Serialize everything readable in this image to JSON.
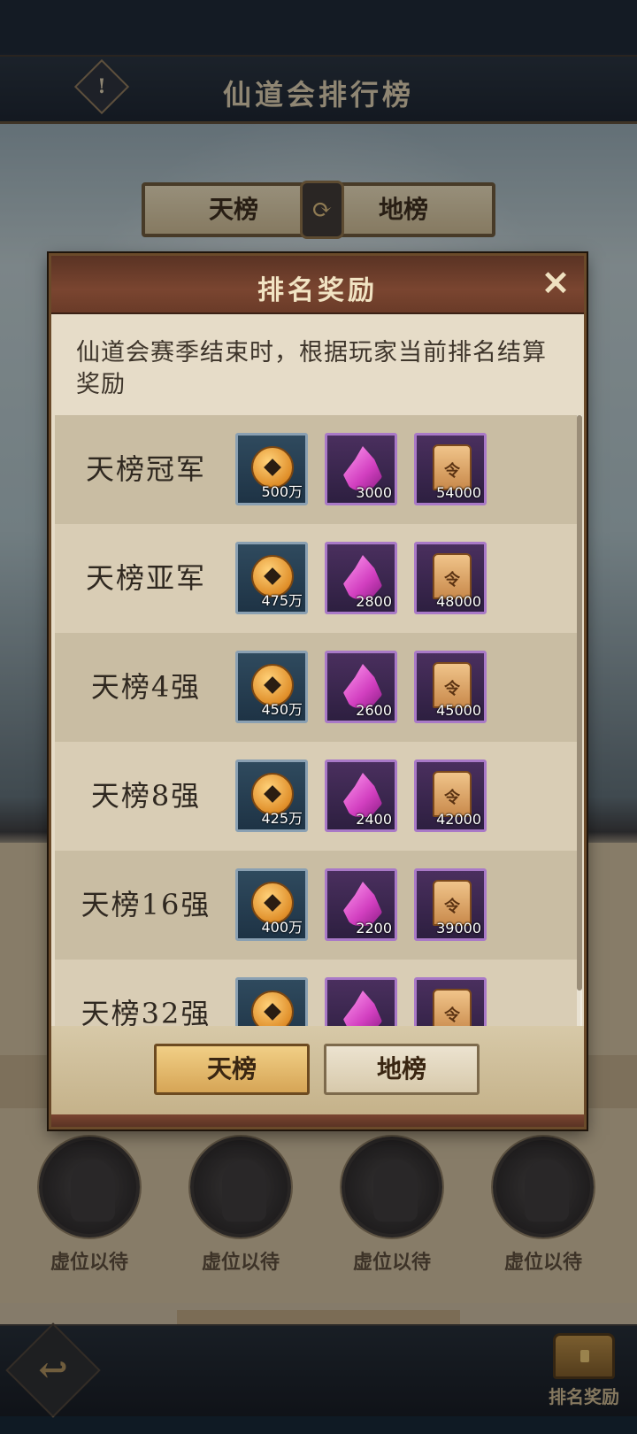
{
  "page": {
    "title": "仙道会排行榜",
    "alert_icon": "!",
    "top_tabs": {
      "left": "天榜",
      "right": "地榜",
      "swap_icon": "swap-icon"
    }
  },
  "modal": {
    "title": "排名奖励",
    "close_icon": "✕",
    "description": "仙道会赛季结束时，根据玩家当前排名结算奖励",
    "rows": [
      {
        "label": "天榜冠军",
        "rewards": [
          "500万",
          "3000",
          "54000"
        ]
      },
      {
        "label": "天榜亚军",
        "rewards": [
          "475万",
          "2800",
          "48000"
        ]
      },
      {
        "label": "天榜4强",
        "rewards": [
          "450万",
          "2600",
          "45000"
        ]
      },
      {
        "label": "天榜8强",
        "rewards": [
          "425万",
          "2400",
          "42000"
        ]
      },
      {
        "label": "天榜16强",
        "rewards": [
          "400万",
          "2200",
          "39000"
        ]
      },
      {
        "label": "天榜32强",
        "rewards": [
          "",
          "",
          ""
        ]
      }
    ],
    "token_glyph": "令",
    "tabs": {
      "active": "天榜",
      "inactive": "地榜"
    }
  },
  "avatars": [
    "虚位以待",
    "虚位以待",
    "虚位以待",
    "虚位以待"
  ],
  "footer": {
    "back_icon": "↩",
    "rank_reward_label": "排名奖励"
  },
  "colors": {
    "accent_gold": "#d6a556",
    "modal_header": "#7a4530",
    "crystal": "#d23fc0",
    "coin": "#e08f2a"
  }
}
